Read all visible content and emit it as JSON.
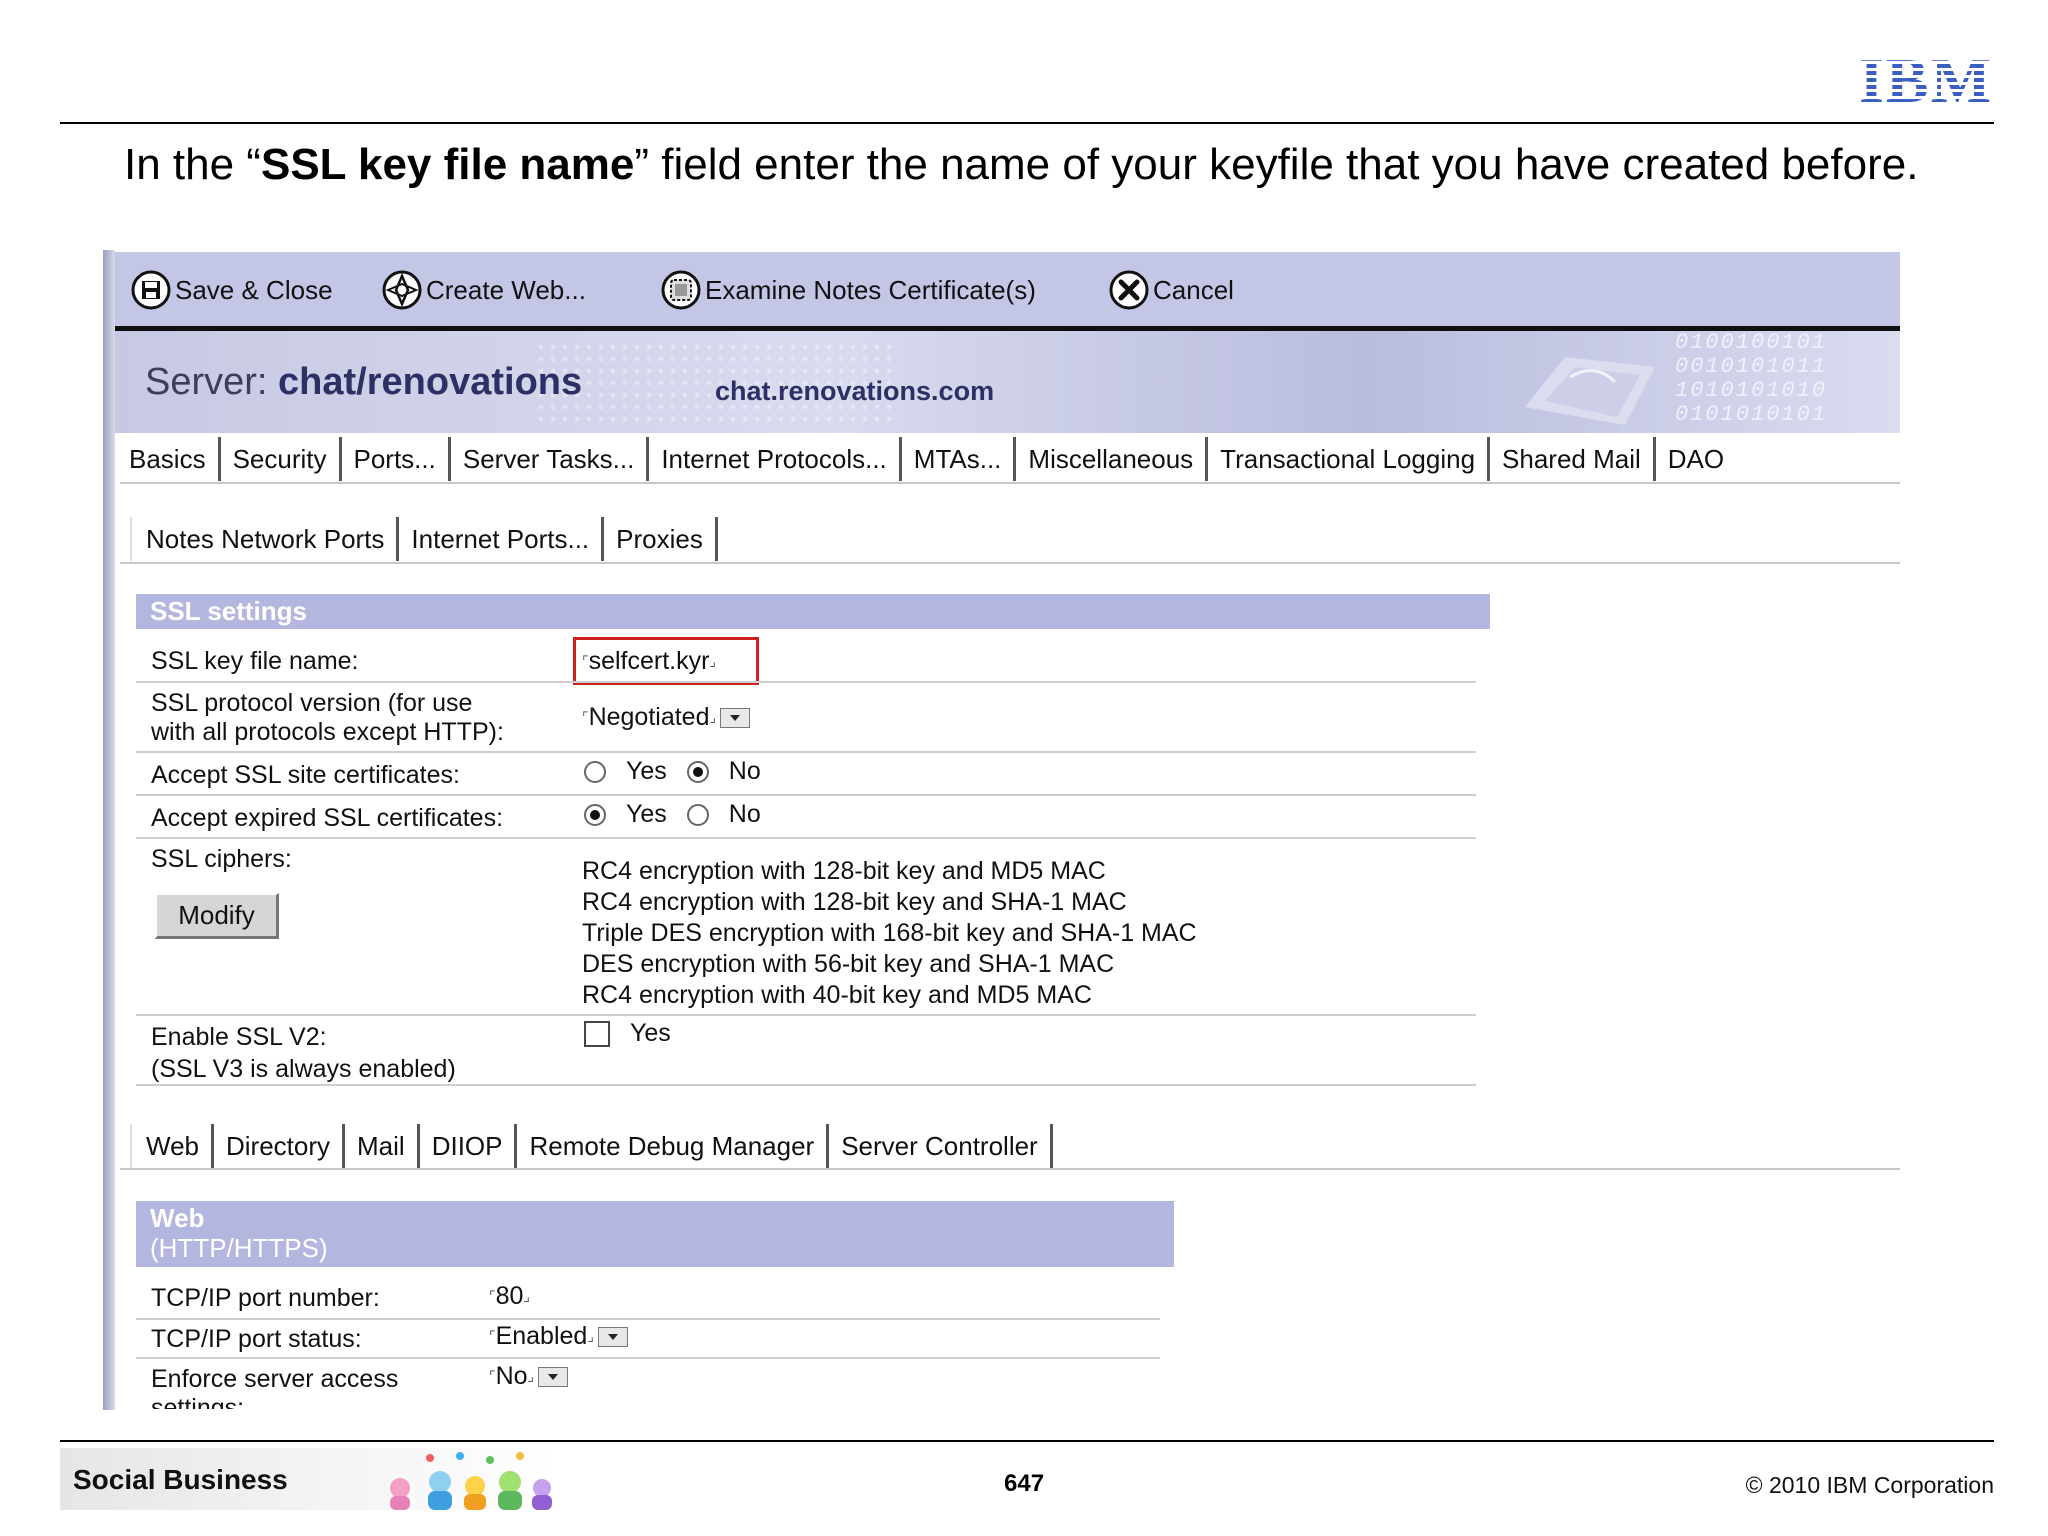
{
  "slide": {
    "logo_text": "IBM",
    "instruction_before": "In the “",
    "instruction_bold": "SSL key file name",
    "instruction_after": "” field enter the name of your keyfile that you have created before.",
    "footer": {
      "brand": "Social Business",
      "page_number": "647",
      "copyright": "© 2010 IBM Corporation"
    }
  },
  "toolbar": {
    "buttons": [
      {
        "label": "Save & Close",
        "icon": "save-icon"
      },
      {
        "label": "Create Web...",
        "icon": "compass-icon"
      },
      {
        "label": "Examine Notes Certificate(s)",
        "icon": "certificate-icon"
      },
      {
        "label": "Cancel",
        "icon": "close-icon"
      }
    ]
  },
  "banner": {
    "server_prefix": "Server: ",
    "server_name": "chat/renovations",
    "domain": "chat.renovations.com",
    "binary_lines": [
      "0100100101",
      "0010101011",
      "1010101010",
      "0101010101"
    ]
  },
  "main_tabs": [
    "Basics",
    "Security",
    "Ports...",
    "Server Tasks...",
    "Internet Protocols...",
    "MTAs...",
    "Miscellaneous",
    "Transactional Logging",
    "Shared Mail",
    "DAO"
  ],
  "port_tabs": [
    "Notes Network Ports",
    "Internet Ports...",
    "Proxies"
  ],
  "ssl": {
    "header": "SSL settings",
    "key_file_label": "SSL key file name:",
    "key_file_value": "selfcert.kyr",
    "protocol_label_1": "SSL protocol version (for use",
    "protocol_label_2": "with all protocols except HTTP):",
    "protocol_value": "Negotiated",
    "accept_site_label": "Accept SSL site certificates:",
    "accept_expired_label": "Accept expired SSL certificates:",
    "yes": "Yes",
    "no": "No",
    "accept_site_selected": "No",
    "accept_expired_selected": "Yes",
    "ciphers_label": "SSL ciphers:",
    "modify_label": "Modify",
    "ciphers": [
      "RC4 encryption with 128-bit key and MD5 MAC",
      "RC4 encryption with 128-bit key and SHA-1 MAC",
      "Triple DES encryption with 168-bit key and SHA-1 MAC",
      "DES encryption with 56-bit key and SHA-1 MAC",
      "RC4 encryption with 40-bit key and MD5 MAC"
    ],
    "v2_label_1": "Enable SSL V2:",
    "v2_label_2": "(SSL V3 is always enabled)",
    "v2_value": "Yes"
  },
  "protocol_tabs": [
    "Web",
    "Directory",
    "Mail",
    "DIIOP",
    "Remote Debug Manager",
    "Server Controller"
  ],
  "web": {
    "header_1": "Web",
    "header_2": "(HTTP/HTTPS)",
    "port_label": "TCP/IP port number:",
    "port_value": "80",
    "status_label": "TCP/IP port status:",
    "status_value": "Enabled",
    "enforce_label_1": "Enforce server access",
    "enforce_label_2": "settings:",
    "enforce_value": "No"
  }
}
